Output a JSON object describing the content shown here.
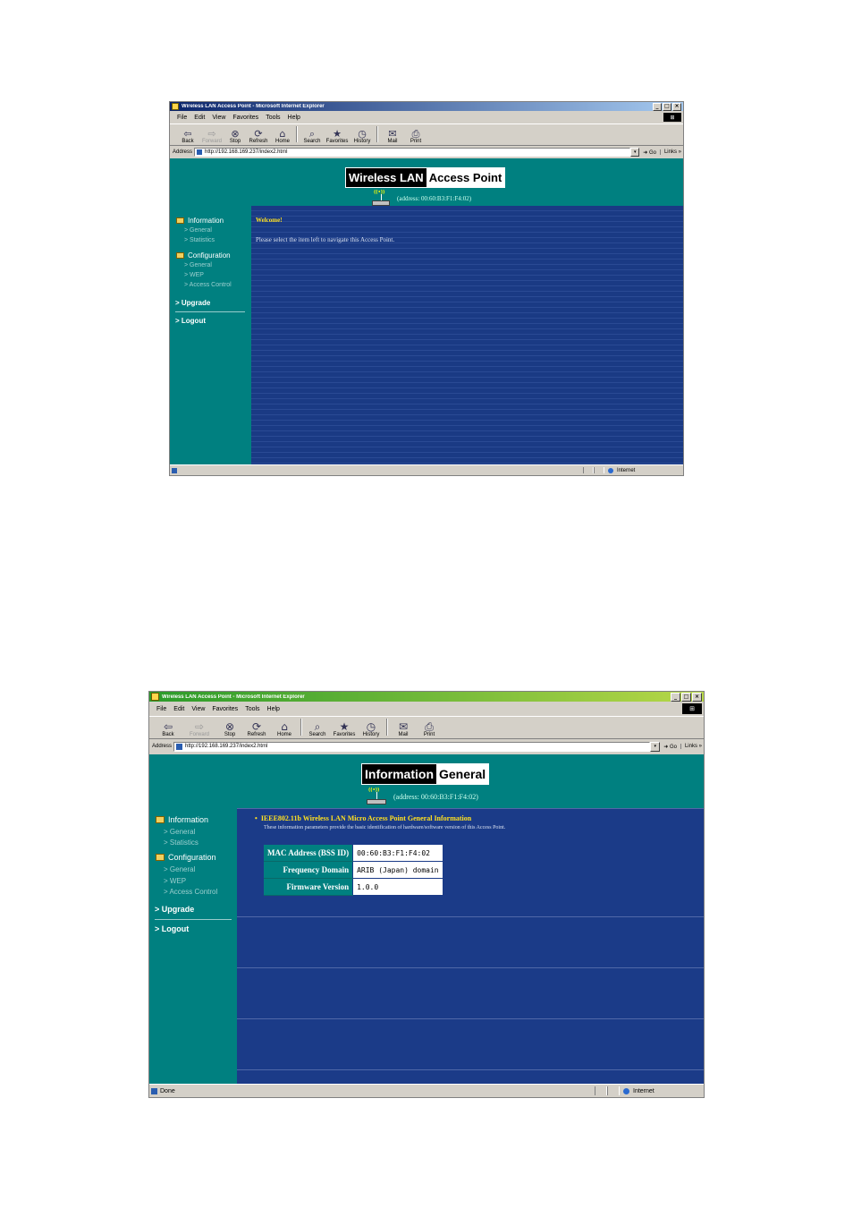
{
  "browser": {
    "menu": [
      "File",
      "Edit",
      "View",
      "Favorites",
      "Tools",
      "Help"
    ],
    "toolbar": [
      {
        "label": "Back",
        "icon": "back-arrow-icon",
        "glyph": "⇦",
        "disabled": false
      },
      {
        "label": "Forward",
        "icon": "forward-arrow-icon",
        "glyph": "⇨",
        "disabled": true
      },
      {
        "label": "Stop",
        "icon": "stop-icon",
        "glyph": "⊗",
        "disabled": false
      },
      {
        "label": "Refresh",
        "icon": "refresh-icon",
        "glyph": "⟳",
        "disabled": false
      },
      {
        "label": "Home",
        "icon": "home-icon",
        "glyph": "⌂",
        "disabled": false
      },
      {
        "label": "Search",
        "icon": "search-icon",
        "glyph": "⌕",
        "disabled": false
      },
      {
        "label": "Favorites",
        "icon": "favorites-icon",
        "glyph": "★",
        "disabled": false
      },
      {
        "label": "History",
        "icon": "history-icon",
        "glyph": "◷",
        "disabled": false
      },
      {
        "label": "Mail",
        "icon": "mail-icon",
        "glyph": "✉",
        "disabled": false
      },
      {
        "label": "Print",
        "icon": "print-icon",
        "glyph": "⎙",
        "disabled": false
      }
    ],
    "address_label": "Address",
    "go_label": "Go",
    "links_label": "Links",
    "zone_label": "Internet"
  },
  "sidebar": {
    "information": "Information",
    "info_items": [
      "> General",
      "> Statistics"
    ],
    "configuration": "Configuration",
    "config_items": [
      "> General",
      "> WEP",
      "> Access Control"
    ],
    "upgrade": "> Upgrade",
    "logout": "> Logout"
  },
  "colors": {
    "title_active": "#0a246a",
    "title_gradient_end": "#a6caf0",
    "teal": "#008080",
    "navy": "#1b3b88",
    "accent_yellow": "#ffe020"
  },
  "screen1": {
    "window_title": "Wireless LAN Access Point - Microsoft Internet Explorer",
    "url": "http://192.168.169.237/index2.html",
    "banner_left": "Wireless LAN",
    "banner_right": "Access Point",
    "device_address": "(address: 00:60:B3:F1:F4:02)",
    "welcome": "Welcome!",
    "message": "Please select the item left to navigate this Access Point.",
    "status_text": ""
  },
  "screen2": {
    "window_title": "Wireless LAN Access Point - Microsoft Internet Explorer",
    "url": "http://192.168.169.237/index2.html",
    "banner_left": "Information",
    "banner_right": "General",
    "device_address": "(address: 00:60:B3:F1:F4:02)",
    "section_title": "IEEE802.11b Wireless LAN Micro Access Point General Information",
    "section_desc": "These information parameters provide the basic identification of hardware/software version of this Access Point.",
    "rows": [
      {
        "label": "MAC Address (BSS ID)",
        "value": "00:60:B3:F1:F4:02"
      },
      {
        "label": "Frequency Domain",
        "value": "ARIB (Japan) domain"
      },
      {
        "label": "Firmware Version",
        "value": "1.0.0"
      }
    ],
    "status_text": "Done"
  }
}
